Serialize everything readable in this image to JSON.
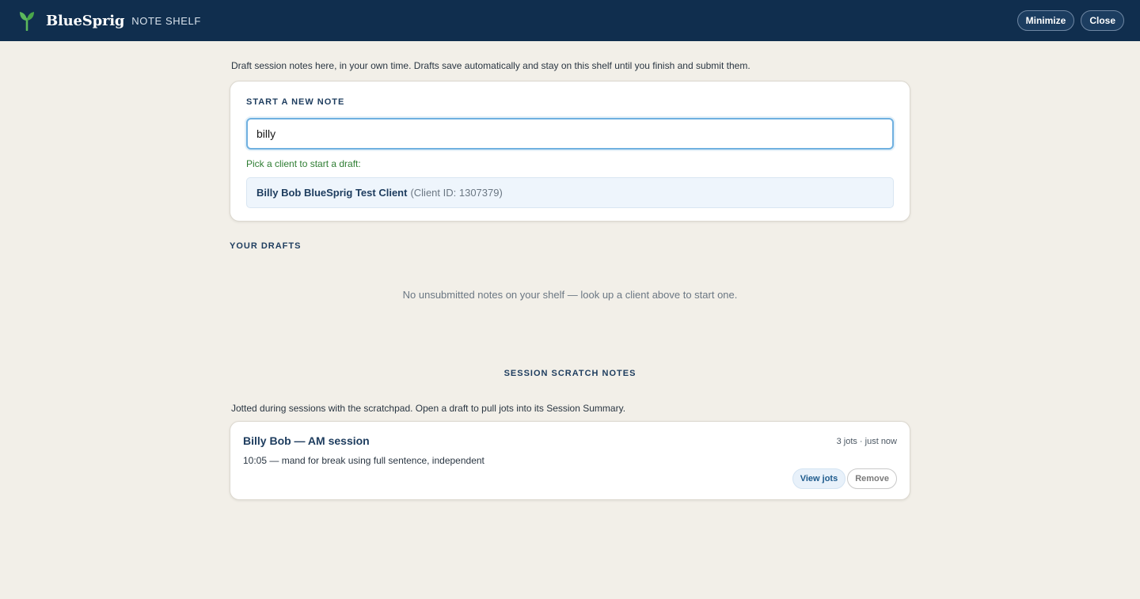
{
  "header": {
    "brand": "BlueSprig",
    "subtitle": "NOTE SHELF",
    "minimize_label": "Minimize",
    "close_label": "Close",
    "colors": {
      "bar": "#102e4e",
      "sprout": "#5cb85c"
    }
  },
  "intro_text": "Draft session notes here, in your own time. Drafts save automatically and stay on this shelf until you finish and submit them.",
  "new_note": {
    "label": "START A NEW NOTE",
    "search_value": "billy",
    "hint": "Pick a client to start a draft:",
    "results": [
      {
        "name": "Billy Bob BlueSprig Test Client",
        "id_text": "(Client ID: 1307379)"
      }
    ]
  },
  "drafts": {
    "label": "YOUR DRAFTS",
    "empty_text": "No unsubmitted notes on your shelf — look up a client above to start one."
  },
  "scratch": {
    "heading": "SESSION SCRATCH NOTES",
    "intro": "Jotted during sessions with the scratchpad. Open a draft to pull jots into its Session Summary.",
    "items": [
      {
        "title": "Billy Bob — AM session",
        "meta": "3 jots · just now",
        "latest_jot": "10:05 — mand for break using full sentence, independent",
        "view_label": "View jots",
        "remove_label": "Remove"
      }
    ]
  }
}
